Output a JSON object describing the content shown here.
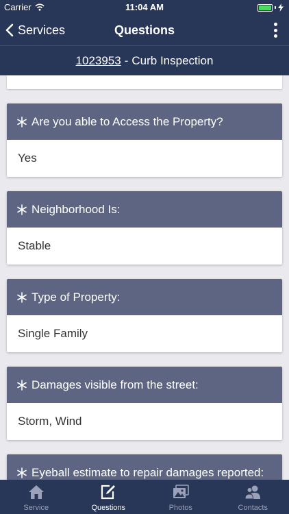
{
  "status_bar": {
    "carrier": "Carrier",
    "time": "11:04 AM"
  },
  "nav": {
    "back_label": "Services",
    "title": "Questions"
  },
  "subheader": {
    "order_number": "1023953",
    "separator": "-",
    "title": "Curb Inspection"
  },
  "questions": [
    {
      "label": "Are you able to Access the Property?",
      "answer": "Yes",
      "required": true
    },
    {
      "label": "Neighborhood Is:",
      "answer": "Stable",
      "required": true
    },
    {
      "label": "Type of Property:",
      "answer": "Single Family",
      "required": true
    },
    {
      "label": "Damages visible from the street:",
      "answer": "Storm, Wind",
      "required": true
    },
    {
      "label": "Eyeball estimate to repair damages reported:",
      "answer": "",
      "required": true
    }
  ],
  "tabs": [
    {
      "label": "Service",
      "icon": "home-icon",
      "active": false
    },
    {
      "label": "Questions",
      "icon": "edit-icon",
      "active": true
    },
    {
      "label": "Photos",
      "icon": "photos-icon",
      "active": false
    },
    {
      "label": "Contacts",
      "icon": "contacts-icon",
      "active": false
    }
  ],
  "colors": {
    "header_bg": "#283658",
    "card_header_bg": "#5e6582",
    "battery": "#4cd964",
    "page_bg": "#e9e9ee"
  }
}
